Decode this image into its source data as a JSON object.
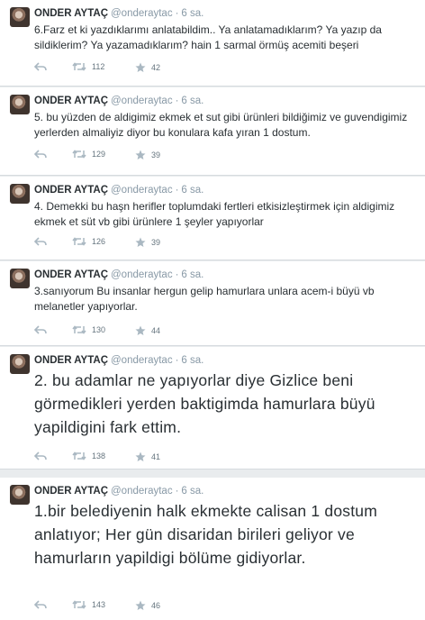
{
  "tweets": [
    {
      "name": "ONDER AYTAÇ",
      "handle": "@onderaytac",
      "time": "6 sa.",
      "text": "6.Farz et ki yazdıklarımı anlatabildim.. Ya anlatamadıklarım? Ya yazıp da sildiklerim? Ya yazamadıklarım? hain 1 sarmal örmüş acemiti beşeri",
      "retweets": "112",
      "favorites": "42"
    },
    {
      "name": "ONDER AYTAÇ",
      "handle": "@onderaytac",
      "time": "6 sa.",
      "text": "5. bu yüzden de aldigimiz ekmek et sut gibi ürünleri bildiğimiz ve guvendigimiz yerlerden almaliyiz diyor bu konulara kafa yıran 1 dostum.",
      "retweets": "129",
      "favorites": "39"
    },
    {
      "name": "ONDER AYTAÇ",
      "handle": "@onderaytac",
      "time": "6 sa.",
      "text": "4. Demekki bu haşn herifler toplumdaki fertleri etkisizleştirmek için aldigimiz ekmek et süt vb gibi ürünlere 1 şeyler yapıyorlar",
      "retweets": "126",
      "favorites": "39"
    },
    {
      "name": "ONDER AYTAÇ",
      "handle": "@onderaytac",
      "time": "6 sa.",
      "text": "3.sanıyorum Bu insanlar hergun gelip hamurlara unlara acem-i büyü vb melanetler yapıyorlar.",
      "retweets": "130",
      "favorites": "44"
    },
    {
      "name": "ONDER AYTAÇ",
      "handle": "@onderaytac",
      "time": "6 sa.",
      "text": "2. bu adamlar ne yapıyorlar diye Gizlice beni görmedikleri yerden baktigimda hamurlara büyü yapildigini fark ettim.",
      "retweets": "138",
      "favorites": "41"
    },
    {
      "name": "ONDER AYTAÇ",
      "handle": "@onderaytac",
      "time": "6 sa.",
      "text": "1.bir belediyenin halk ekmekte calisan 1 dostum anlatıyor; Her gün disaridan birileri geliyor ve hamurların yapildigi bölüme gidiyorlar.",
      "retweets": "143",
      "favorites": "46"
    }
  ],
  "icons": {
    "reply": "reply-icon",
    "retweet": "retweet-icon",
    "favorite": "star-icon"
  },
  "colors": {
    "text": "#292f33",
    "muted": "#8899a6",
    "background": "#e9ecee",
    "card": "#ffffff"
  }
}
